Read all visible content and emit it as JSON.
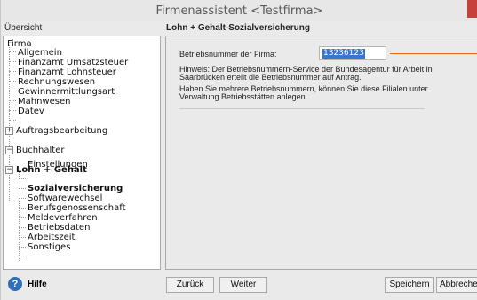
{
  "window": {
    "title": "Firmenassistent <Testfirma>"
  },
  "left_panel": {
    "header": "Übersicht",
    "tree": [
      {
        "label": "Firma",
        "level": 0,
        "bold": false
      },
      {
        "label": "Allgemein",
        "level": 1
      },
      {
        "label": "Finanzamt Umsatzsteuer",
        "level": 1
      },
      {
        "label": "Finanzamt Lohnsteuer",
        "level": 1
      },
      {
        "label": "Rechnungswesen",
        "level": 1
      },
      {
        "label": "Gewinnermittlungsart",
        "level": 1
      },
      {
        "label": "Mahnwesen",
        "level": 1
      },
      {
        "label": "Datev",
        "level": 1
      },
      {
        "label": "Auftragsbearbeitung",
        "level": 1,
        "expander": "+"
      },
      {
        "label": "Buchhalter",
        "level": 1,
        "expander": "-"
      },
      {
        "label": "Einstellungen",
        "level": 2
      },
      {
        "label": "Lohn + Gehalt",
        "level": 1,
        "expander": "-",
        "bold": true
      },
      {
        "label": "Sozialversicherung",
        "level": 2,
        "bold": true,
        "selected": true
      },
      {
        "label": "Softwarewechsel",
        "level": 2
      },
      {
        "label": "Berufsgenossenschaft",
        "level": 2
      },
      {
        "label": "Meldeverfahren",
        "level": 2
      },
      {
        "label": "Betriebsdaten",
        "level": 2
      },
      {
        "label": "Arbeitszeit",
        "level": 2
      },
      {
        "label": "Sonstiges",
        "level": 2
      }
    ]
  },
  "content": {
    "header": "Lohn + Gehalt-Sozialversicherung",
    "field_label": "Betriebsnummer der Firma:",
    "field_value": "13236123",
    "hint_line1": "Hinweis: Der Betriebsnummern-Service der Bundesagentur für Arbeit in",
    "hint_line2": "Saarbrücken erteilt die Betriebsnummer auf Antrag.",
    "hint_line3": "Haben Sie mehrere Betriebsnummern, können Sie diese Filialen unter",
    "hint_line4": "Verwaltung Betriebsstätten anlegen."
  },
  "footer": {
    "help_label": "Hilfe",
    "back_label": "Zurück",
    "next_label": "Weiter",
    "save_label": "Speichern",
    "cancel_label": "Abbrechen"
  },
  "colors": {
    "selection": "#3875d7",
    "callout": "#e2661e",
    "close": "#c7403b",
    "help_icon": "#2f6fbe"
  }
}
